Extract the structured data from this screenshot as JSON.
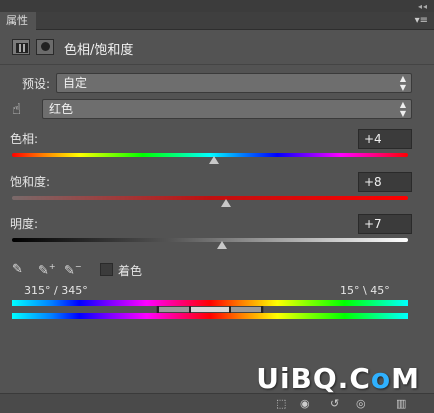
{
  "window": {
    "tab_label": "属性",
    "panel_name": "色相/饱和度"
  },
  "preset": {
    "label": "预设:",
    "value": "自定"
  },
  "channel": {
    "value": "红色"
  },
  "sliders": [
    {
      "label": "色相:",
      "value": "+4",
      "fraction": 0.51
    },
    {
      "label": "饱和度:",
      "value": "+8",
      "fraction": 0.54
    },
    {
      "label": "明度:",
      "value": "+7",
      "fraction": 0.53
    }
  ],
  "colorize": {
    "label": "着色",
    "checked": false
  },
  "range": {
    "left": "315° / 345°",
    "right": "15° \\ 45°"
  },
  "watermark": {
    "text_a": "UiBQ.C",
    "text_o": "o",
    "text_b": "M"
  },
  "icons": {
    "adjustment": "adjustment-layer-icon",
    "mask": "mask-icon",
    "hand": "targeted-adjustment-hand-icon",
    "eyedropper": "eyedropper-icon",
    "eyedropper_add": "eyedropper-plus-icon",
    "eyedropper_sub": "eyedropper-minus-icon"
  }
}
